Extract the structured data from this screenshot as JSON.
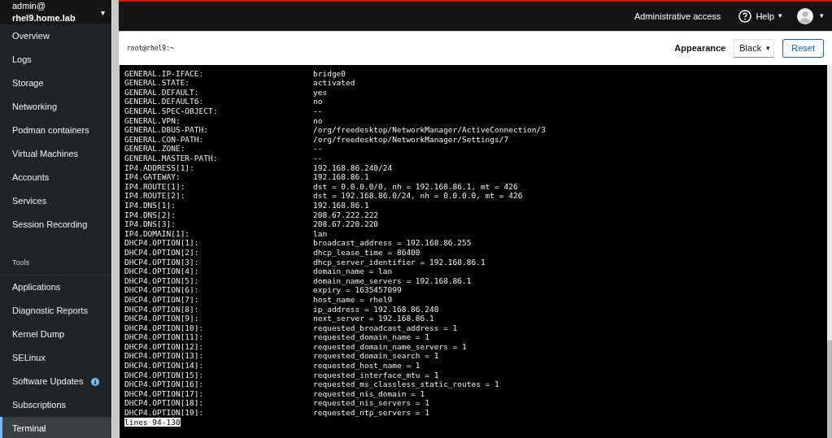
{
  "host": {
    "user": "admin@",
    "name": "rhel9.home.lab",
    "caret": "▾"
  },
  "sidebar": {
    "items": [
      {
        "kind": "item",
        "label": "Overview",
        "selected": false,
        "badge": false
      },
      {
        "kind": "item",
        "label": "Logs",
        "selected": false,
        "badge": false
      },
      {
        "kind": "item",
        "label": "Storage",
        "selected": false,
        "badge": false
      },
      {
        "kind": "item",
        "label": "Networking",
        "selected": false,
        "badge": false
      },
      {
        "kind": "item",
        "label": "Podman containers",
        "selected": false,
        "badge": false
      },
      {
        "kind": "item",
        "label": "Virtual Machines",
        "selected": false,
        "badge": false
      },
      {
        "kind": "item",
        "label": "Accounts",
        "selected": false,
        "badge": false
      },
      {
        "kind": "item",
        "label": "Services",
        "selected": false,
        "badge": false
      },
      {
        "kind": "item",
        "label": "Session Recording",
        "selected": false,
        "badge": false
      },
      {
        "kind": "heading",
        "label": "Tools"
      },
      {
        "kind": "item",
        "label": "Applications",
        "selected": false,
        "badge": false
      },
      {
        "kind": "item",
        "label": "Diagnostic Reports",
        "selected": false,
        "badge": false
      },
      {
        "kind": "item",
        "label": "Kernel Dump",
        "selected": false,
        "badge": false
      },
      {
        "kind": "item",
        "label": "SELinux",
        "selected": false,
        "badge": false
      },
      {
        "kind": "item",
        "label": "Software Updates",
        "selected": false,
        "badge": true
      },
      {
        "kind": "item",
        "label": "Subscriptions",
        "selected": false,
        "badge": false
      },
      {
        "kind": "item",
        "label": "Terminal",
        "selected": true,
        "badge": false
      }
    ]
  },
  "topbar": {
    "access": "Administrative access",
    "help": "Help",
    "help_caret": "▾",
    "user_caret": "▾"
  },
  "toolbar": {
    "title": "root@rhel9:~",
    "appearance_label": "Appearance",
    "appearance_value": "Black",
    "appearance_caret": "▾",
    "reset": "Reset"
  },
  "terminal": {
    "lines": [
      {
        "key": "GENERAL.IP-IFACE:",
        "value": "bridge0"
      },
      {
        "key": "GENERAL.STATE:",
        "value": "activated"
      },
      {
        "key": "GENERAL.DEFAULT:",
        "value": "yes"
      },
      {
        "key": "GENERAL.DEFAULT6:",
        "value": "no"
      },
      {
        "key": "GENERAL.SPEC-OBJECT:",
        "value": "--"
      },
      {
        "key": "GENERAL.VPN:",
        "value": "no"
      },
      {
        "key": "GENERAL.DBUS-PATH:",
        "value": "/org/freedesktop/NetworkManager/ActiveConnection/3"
      },
      {
        "key": "GENERAL.CON-PATH:",
        "value": "/org/freedesktop/NetworkManager/Settings/7"
      },
      {
        "key": "GENERAL.ZONE:",
        "value": "--"
      },
      {
        "key": "GENERAL.MASTER-PATH:",
        "value": "--"
      },
      {
        "key": "IP4.ADDRESS[1]:",
        "value": "192.168.86.240/24"
      },
      {
        "key": "IP4.GATEWAY:",
        "value": "192.168.86.1"
      },
      {
        "key": "IP4.ROUTE[1]:",
        "value": "dst = 0.0.0.0/0, nh = 192.168.86.1, mt = 426"
      },
      {
        "key": "IP4.ROUTE[2]:",
        "value": "dst = 192.168.86.0/24, nh = 0.0.0.0, mt = 426"
      },
      {
        "key": "IP4.DNS[1]:",
        "value": "192.168.86.1"
      },
      {
        "key": "IP4.DNS[2]:",
        "value": "208.67.222.222"
      },
      {
        "key": "IP4.DNS[3]:",
        "value": "208.67.220.220"
      },
      {
        "key": "IP4.DOMAIN[1]:",
        "value": "lan"
      },
      {
        "key": "DHCP4.OPTION[1]:",
        "value": "broadcast_address = 192.168.86.255"
      },
      {
        "key": "DHCP4.OPTION[2]:",
        "value": "dhcp_lease_time = 86400"
      },
      {
        "key": "DHCP4.OPTION[3]:",
        "value": "dhcp_server_identifier = 192.168.86.1"
      },
      {
        "key": "DHCP4.OPTION[4]:",
        "value": "domain_name = lan"
      },
      {
        "key": "DHCP4.OPTION[5]:",
        "value": "domain_name_servers = 192.168.86.1"
      },
      {
        "key": "DHCP4.OPTION[6]:",
        "value": "expiry = 1635457099"
      },
      {
        "key": "DHCP4.OPTION[7]:",
        "value": "host_name = rhel9"
      },
      {
        "key": "DHCP4.OPTION[8]:",
        "value": "ip_address = 192.168.86.240"
      },
      {
        "key": "DHCP4.OPTION[9]:",
        "value": "next_server = 192.168.86.1"
      },
      {
        "key": "DHCP4.OPTION[10]:",
        "value": "requested_broadcast_address = 1"
      },
      {
        "key": "DHCP4.OPTION[11]:",
        "value": "requested_domain_name = 1"
      },
      {
        "key": "DHCP4.OPTION[12]:",
        "value": "requested_domain_name_servers = 1"
      },
      {
        "key": "DHCP4.OPTION[13]:",
        "value": "requested_domain_search = 1"
      },
      {
        "key": "DHCP4.OPTION[14]:",
        "value": "requested_host_name = 1"
      },
      {
        "key": "DHCP4.OPTION[15]:",
        "value": "requested_interface_mtu = 1"
      },
      {
        "key": "DHCP4.OPTION[16]:",
        "value": "requested_ms_classless_static_routes = 1"
      },
      {
        "key": "DHCP4.OPTION[17]:",
        "value": "requested_nis_domain = 1"
      },
      {
        "key": "DHCP4.OPTION[18]:",
        "value": "requested_nis_servers = 1"
      },
      {
        "key": "DHCP4.OPTION[19]:",
        "value": "requested_ntp_servers = 1"
      }
    ],
    "pager_status": "lines 94-130"
  }
}
